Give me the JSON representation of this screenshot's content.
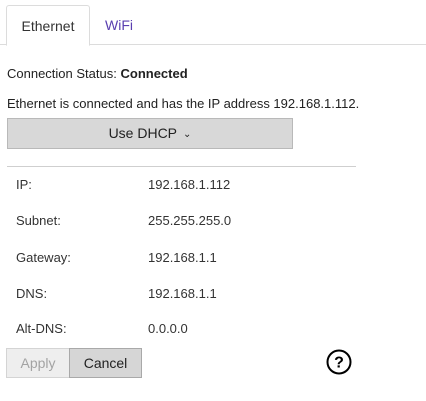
{
  "tabs": [
    {
      "label": "Ethernet",
      "active": true
    },
    {
      "label": "WiFi",
      "active": false
    }
  ],
  "status": {
    "label": "Connection Status:",
    "value": "Connected"
  },
  "info_text": "Ethernet is connected and has the IP address 192.168.1.112.",
  "dhcp_button": {
    "label": "Use DHCP",
    "icon": "chevron-down-icon"
  },
  "fields": [
    {
      "label": "IP:",
      "value": "192.168.1.112"
    },
    {
      "label": "Subnet:",
      "value": "255.255.255.0"
    },
    {
      "label": "Gateway:",
      "value": "192.168.1.1"
    },
    {
      "label": "DNS:",
      "value": "192.168.1.1"
    },
    {
      "label": "Alt-DNS:",
      "value": "0.0.0.0"
    }
  ],
  "buttons": {
    "apply_label": "Apply",
    "cancel_label": "Cancel"
  },
  "help_icon": "help-icon",
  "colors": {
    "tab_link": "#5a3fb0",
    "button_bg": "#d8d8d8",
    "disabled_text": "#a3a3a3"
  }
}
